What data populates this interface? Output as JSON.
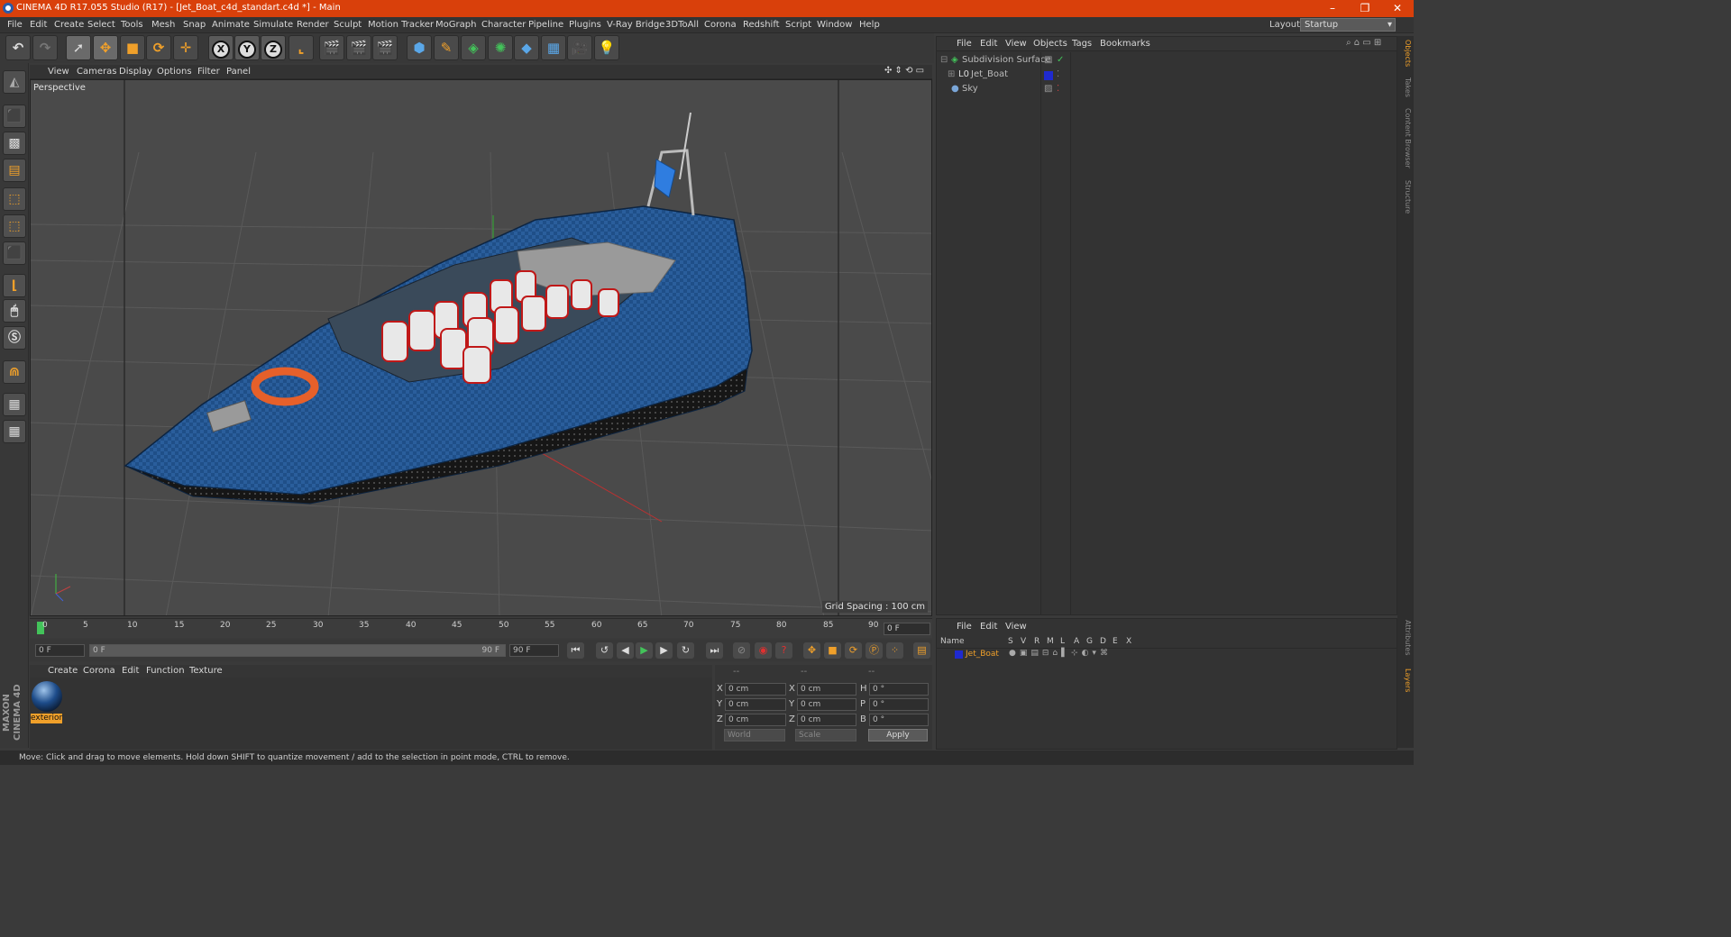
{
  "window": {
    "title": "CINEMA 4D R17.055 Studio (R17) - [Jet_Boat_c4d_standart.c4d *] - Main",
    "min": "–",
    "restore": "❐",
    "close": "✕"
  },
  "menubar": [
    "File",
    "Edit",
    "Create",
    "Select",
    "Tools",
    "Mesh",
    "Snap",
    "Animate",
    "Simulate",
    "Render",
    "Sculpt",
    "Motion Tracker",
    "MoGraph",
    "Character",
    "Pipeline",
    "Plugins",
    "V-Ray Bridge",
    "3DToAll",
    "Corona",
    "Redshift",
    "Script",
    "Window",
    "Help"
  ],
  "layout": {
    "label": "Layout:",
    "value": "Startup"
  },
  "viewport": {
    "menus": [
      "View",
      "Cameras",
      "Display",
      "Options",
      "Filter",
      "Panel"
    ],
    "label": "Perspective",
    "grid_spacing": "Grid Spacing : 100 cm"
  },
  "objects": {
    "menus": [
      "File",
      "Edit",
      "View",
      "Objects",
      "Tags",
      "Bookmarks"
    ],
    "items": [
      {
        "name": "Subdivision Surface"
      },
      {
        "name": "Jet_Boat"
      },
      {
        "name": "Sky"
      }
    ]
  },
  "right_tabs": [
    "Objects",
    "Takes",
    "Content Browser",
    "Structure",
    "Attributes",
    "Layers"
  ],
  "timeline": {
    "ticks": [
      "0",
      "5",
      "10",
      "15",
      "20",
      "25",
      "30",
      "35",
      "40",
      "45",
      "50",
      "55",
      "60",
      "65",
      "70",
      "75",
      "80",
      "85",
      "90"
    ],
    "end_box": "0 F"
  },
  "transport": {
    "start": "0 F",
    "range_start": "0 F",
    "range_end": "90 F",
    "end": "90 F"
  },
  "materials": {
    "menus": [
      "Create",
      "Corona",
      "Edit",
      "Function",
      "Texture"
    ],
    "items": [
      {
        "name": "exterior"
      }
    ]
  },
  "coords": {
    "headers": [
      "--",
      "--",
      "--"
    ],
    "rows": [
      {
        "a": "X",
        "v1": "0 cm",
        "b": "X",
        "v2": "0 cm",
        "c": "H",
        "v3": "0 °"
      },
      {
        "a": "Y",
        "v1": "0 cm",
        "b": "Y",
        "v2": "0 cm",
        "c": "P",
        "v3": "0 °"
      },
      {
        "a": "Z",
        "v1": "0 cm",
        "b": "Z",
        "v2": "0 cm",
        "c": "B",
        "v3": "0 °"
      }
    ],
    "world": "World",
    "scale": "Scale",
    "apply": "Apply"
  },
  "layers": {
    "menus": [
      "File",
      "Edit",
      "View"
    ],
    "columns": [
      "Name",
      "S",
      "V",
      "R",
      "M",
      "L",
      "A",
      "G",
      "D",
      "E",
      "X"
    ],
    "row": "Jet_Boat"
  },
  "brand": "MAXON CINEMA 4D",
  "status": "Move: Click and drag to move elements. Hold down SHIFT to quantize movement / add to the selection in point mode, CTRL to remove.",
  "colors": {
    "title_bar": "#d9400b",
    "accent": "#f0a02a",
    "boat": "#1e4f86"
  }
}
